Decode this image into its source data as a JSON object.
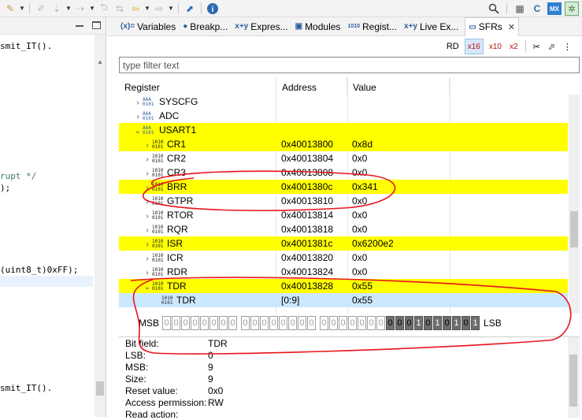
{
  "editor": {
    "lines": [
      {
        "text": "smit_IT().",
        "kind": "code"
      },
      {
        "text": "rupt */",
        "kind": "comment"
      },
      {
        "text": ");",
        "kind": "code"
      },
      {
        "text": "(uint8_t)0xFF);",
        "kind": "code"
      },
      {
        "text": "smit_IT().",
        "kind": "code"
      }
    ]
  },
  "tabs": [
    {
      "label": "Variables",
      "icon": "(x)="
    },
    {
      "label": "Breakp...",
      "icon": "●"
    },
    {
      "label": "Expres...",
      "icon": "x+y"
    },
    {
      "label": "Modules",
      "icon": "▣"
    },
    {
      "label": "Regist...",
      "icon": "1010"
    },
    {
      "label": "Live Ex...",
      "icon": "x+y"
    },
    {
      "label": "SFRs",
      "icon": "▭",
      "active": true
    }
  ],
  "subbar": {
    "rd": "RD",
    "hex": "x16",
    "dec": "x10",
    "bin": "x2"
  },
  "filter": {
    "placeholder": "type filter text"
  },
  "columns": {
    "register": "Register",
    "address": "Address",
    "value": "Value"
  },
  "rows": [
    {
      "name": "SYSCFG",
      "address": "",
      "value": "",
      "indent": 1,
      "chev": "›",
      "type": "group",
      "hl": ""
    },
    {
      "name": "ADC",
      "address": "",
      "value": "",
      "indent": 1,
      "chev": "›",
      "type": "group",
      "hl": ""
    },
    {
      "name": "USART1",
      "address": "",
      "value": "",
      "indent": 1,
      "chev": "⌄",
      "type": "group",
      "hl": "yellow"
    },
    {
      "name": "CR1",
      "address": "0x40013800",
      "value": "0x8d",
      "indent": 2,
      "chev": "›",
      "type": "reg",
      "hl": "yellow"
    },
    {
      "name": "CR2",
      "address": "0x40013804",
      "value": "0x0",
      "indent": 2,
      "chev": "›",
      "type": "reg",
      "hl": ""
    },
    {
      "name": "CR3",
      "address": "0x40013808",
      "value": "0x0",
      "indent": 2,
      "chev": "›",
      "type": "reg",
      "hl": ""
    },
    {
      "name": "BRR",
      "address": "0x4001380c",
      "value": "0x341",
      "indent": 2,
      "chev": "›",
      "type": "reg",
      "hl": "yellow"
    },
    {
      "name": "GTPR",
      "address": "0x40013810",
      "value": "0x0",
      "indent": 2,
      "chev": "›",
      "type": "reg",
      "hl": ""
    },
    {
      "name": "RTOR",
      "address": "0x40013814",
      "value": "0x0",
      "indent": 2,
      "chev": "›",
      "type": "reg",
      "hl": ""
    },
    {
      "name": "RQR",
      "address": "0x40013818",
      "value": "0x0",
      "indent": 2,
      "chev": "›",
      "type": "reg",
      "hl": ""
    },
    {
      "name": "ISR",
      "address": "0x4001381c",
      "value": "0x6200e2",
      "indent": 2,
      "chev": "›",
      "type": "reg",
      "hl": "yellow"
    },
    {
      "name": "ICR",
      "address": "0x40013820",
      "value": "0x0",
      "indent": 2,
      "chev": "›",
      "type": "reg",
      "hl": ""
    },
    {
      "name": "RDR",
      "address": "0x40013824",
      "value": "0x0",
      "indent": 2,
      "chev": "›",
      "type": "reg",
      "hl": ""
    },
    {
      "name": "TDR",
      "address": "0x40013828",
      "value": "0x55",
      "indent": 2,
      "chev": "⌄",
      "type": "reg",
      "hl": "yellow"
    },
    {
      "name": "TDR",
      "address": "[0:9]",
      "value": "0x55",
      "indent": 3,
      "chev": "",
      "type": "field",
      "hl": "sel"
    }
  ],
  "bits": {
    "msb_label": "MSB",
    "lsb_label": "LSB",
    "values": [
      "0",
      "0",
      "0",
      "0",
      "0",
      "0",
      "0",
      "0",
      "0",
      "0",
      "0",
      "0",
      "0",
      "0",
      "0",
      "0",
      "0",
      "0",
      "0",
      "0",
      "0",
      "0",
      "0",
      "0",
      "0",
      "0",
      "1",
      "0",
      "1",
      "0",
      "1",
      "0",
      "1"
    ],
    "active_count": 10
  },
  "details": [
    {
      "label": "Bit field:",
      "value": "TDR"
    },
    {
      "label": "LSB:",
      "value": "0"
    },
    {
      "label": "MSB:",
      "value": "9"
    },
    {
      "label": "Size:",
      "value": "9"
    },
    {
      "label": "Reset value:",
      "value": "0x0"
    },
    {
      "label": "Access permission:",
      "value": "RW"
    },
    {
      "label": "Read action:",
      "value": ""
    }
  ],
  "colors": {
    "highlight": "#ffff00",
    "selection": "#cce8ff",
    "annotation": "#e8141c"
  }
}
